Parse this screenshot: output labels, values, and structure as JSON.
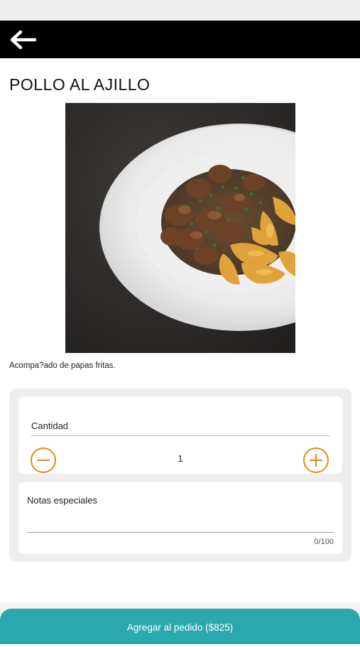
{
  "header": {
    "back_icon": "arrow-left-icon",
    "bar_color": "#000000"
  },
  "product": {
    "title": "POLLO AL AJILLO",
    "image_description": "Plate of chicken with garlic and fried potato wedges",
    "description": "Acompa?ado de papas fritas."
  },
  "quantity": {
    "label": "Cantidad",
    "value": "1",
    "minus_icon": "minus-circle-icon",
    "plus_icon": "plus-circle-icon",
    "accent_color": "#e08a12"
  },
  "notes": {
    "label": "Notas especiales",
    "value": "",
    "counter": "0/100"
  },
  "cta": {
    "label": "Agregar al pedido ($825)",
    "color": "#2aa8ad"
  }
}
